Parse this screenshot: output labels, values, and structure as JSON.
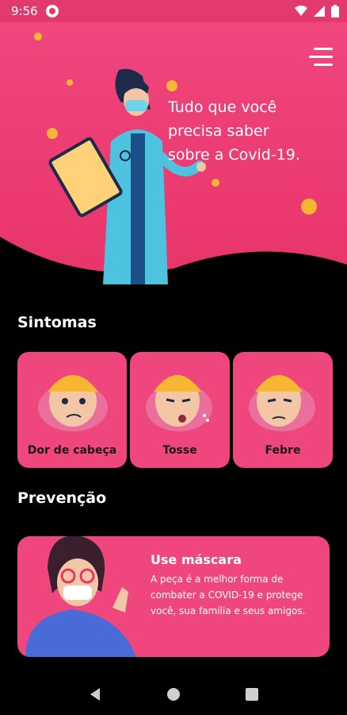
{
  "status_bar": {
    "time": "9:56"
  },
  "hero": {
    "line1": "Tudo que você",
    "line2": "precisa saber",
    "line3": "sobre a Covid-19."
  },
  "symptoms": {
    "title": "Sintomas",
    "items": [
      {
        "label": "Dor de cabeça"
      },
      {
        "label": "Tosse"
      },
      {
        "label": "Febre"
      }
    ]
  },
  "prevention": {
    "title": "Prevenção",
    "card": {
      "title": "Use máscara",
      "description": "A peça é a melhor forma de combater a COVID-19 e protege você, sua família e seus amigos."
    }
  },
  "colors": {
    "primary": "#f0467e",
    "status": "#e23a6e",
    "background": "#000000"
  }
}
